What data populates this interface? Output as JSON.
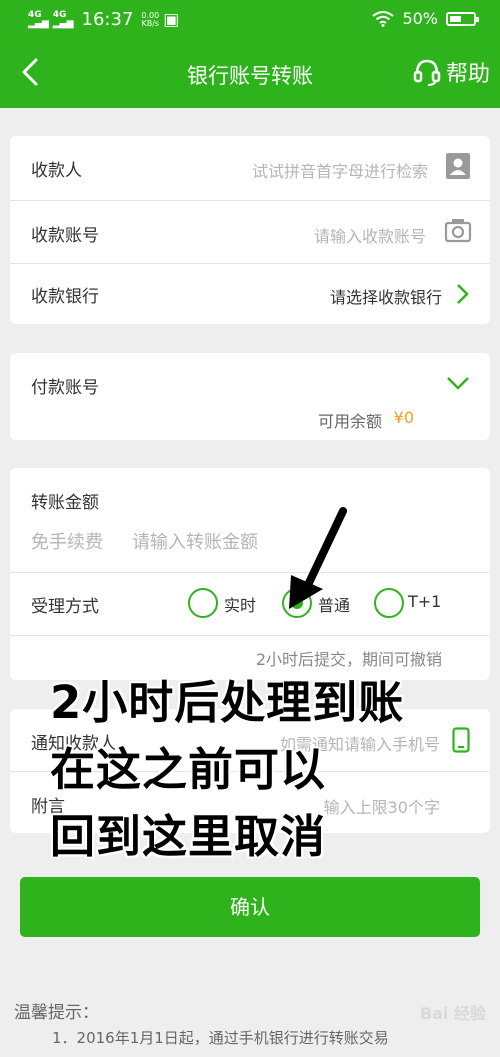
{
  "status_bar": {
    "sig1": "4G",
    "sig2": "4G",
    "time": "16:37",
    "speed_value": "0.00",
    "speed_unit": "KB/s",
    "battery": "50%"
  },
  "header": {
    "title": "银行账号转账",
    "help_label": "帮助"
  },
  "payee_card": {
    "payee_label": "收款人",
    "payee_placeholder": "试试拼音首字母进行检索",
    "account_label": "收款账号",
    "account_placeholder": "请输入收款账号",
    "bank_label": "收款银行",
    "bank_value": "请选择收款银行"
  },
  "pay_card": {
    "account_label": "付款账号",
    "balance_label": "可用余额",
    "balance_value": "¥0"
  },
  "amount_card": {
    "amount_label": "转账金额",
    "fee_note": "免手续费",
    "amount_placeholder": "请输入转账金额",
    "mode_label": "受理方式",
    "mode_options": [
      "实时",
      "普通",
      "T+1"
    ],
    "mode_selected": "普通",
    "mode_hint": "2小时后提交，期间可撤销"
  },
  "notify_card": {
    "notify_label": "通知收款人",
    "notify_placeholder": "如需通知请输入手机号",
    "note_label": "附言",
    "note_placeholder": "输入上限30个字"
  },
  "confirm_label": "确认",
  "annotation": {
    "line1": "2小时后处理到账",
    "line2": "在这之前可以",
    "line3": "回到这里取消"
  },
  "tips": {
    "title": "温馨提示：",
    "item1": "1．2016年1月1日起，通过手机银行进行转账交易"
  },
  "watermark": "Bai 经验",
  "colors": {
    "brand": "#2fb31c",
    "balance": "#f0a020"
  }
}
